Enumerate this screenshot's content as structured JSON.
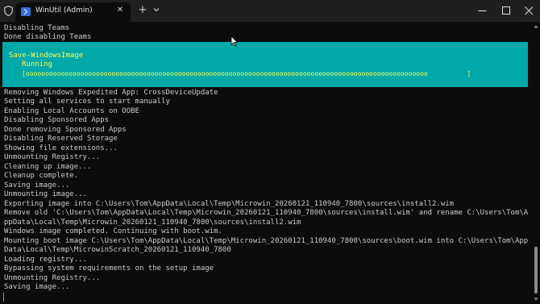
{
  "tab": {
    "title": "WinUtil (Admin)",
    "icon": "terminal-icon",
    "close_glyph": "✕"
  },
  "toolbar": {
    "new_tab_glyph": "+",
    "dropdown_icon": "chevron-down-icon"
  },
  "window_controls": [
    "minimize-icon",
    "maximize-icon",
    "close-icon"
  ],
  "colors": {
    "background": "#0c0c0c",
    "text": "#cccccc",
    "banner_background": "#00a8a8",
    "banner_text": "#ffff55",
    "accent": "#2f6fd6"
  },
  "terminal": {
    "top_lines": [
      "Disabling Teams",
      "Done disabling Teams"
    ],
    "banner": {
      "title": "Save-WindowsImage",
      "status": "Running",
      "progress_text": "[ooooooooooooooooooooooooooooooooooooooooooooooooooooooooooooooooooooooooooooooooooooooooooooooooooooooo          ]"
    },
    "lines": [
      "Removing Windows Expedited App: CrossDeviceUpdate",
      "Setting all services to start manually",
      "Enabling Local Accounts on OOBE",
      "Disabling Sponsored Apps",
      "Done removing Sponsored Apps",
      "Disabling Reserved Storage",
      "Showing file extensions...",
      "Unmounting Registry...",
      "Cleaning up image...",
      "Cleanup complete.",
      "Saving image...",
      "Unmounting image...",
      "Exporting image into C:\\Users\\Tom\\AppData\\Local\\Temp\\Microwin_20260121_110940_7800\\sources\\install2.wim",
      "Remove old 'C:\\Users\\Tom\\AppData\\Local\\Temp\\Microwin_20260121_110940_7800\\sources\\install.wim' and rename C:\\Users\\Tom\\A",
      "ppData\\Local\\Temp\\Microwin_20260121_110940_7800\\sources\\install2.wim",
      "Windows image completed. Continuing with boot.wim.",
      "Mounting boot image C:\\Users\\Tom\\AppData\\Local\\Temp\\Microwin_20260121_110940_7800\\sources\\boot.wim into C:\\Users\\Tom\\App",
      "Data\\Local\\Temp\\MicrowinScratch_20260121_110940_7800",
      "Loading registry...",
      "Bypassing system requirements on the setup image",
      "Unmounting Registry...",
      "Saving image..."
    ]
  }
}
